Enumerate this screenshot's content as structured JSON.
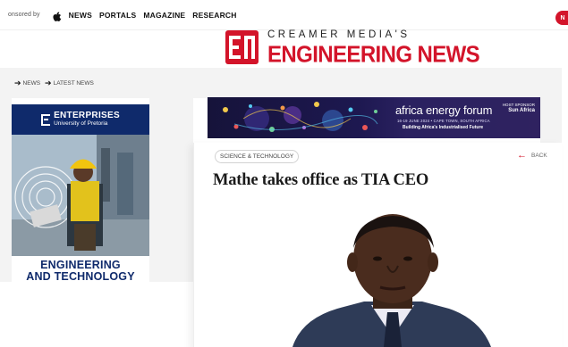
{
  "topbar": {
    "sponsored_text": "onsored by",
    "nav": [
      "NEWS",
      "PORTALS",
      "MAGAZINE",
      "RESEARCH"
    ],
    "user_badge": "N"
  },
  "logo": {
    "top": "CREAMER MEDIA'S",
    "bottom": "ENGINEERING NEWS"
  },
  "breadcrumb": [
    "NEWS",
    "LATEST NEWS"
  ],
  "left_ad": {
    "brand": "ENTERPRISES",
    "brand_sub": "University of Pretoria",
    "foot_line1": "ENGINEERING",
    "foot_line2": "AND TECHNOLOGY"
  },
  "banner": {
    "title": "africa energy forum",
    "sub1": "16-19 JUNE 2024 • CAPE TOWN, SOUTH AFRICA",
    "sub2": "Building Africa's Industrialised Future",
    "sponsor_label": "HOST SPONSOR",
    "sponsor_name": "Sun Africa"
  },
  "article": {
    "category": "SCIENCE & TECHNOLOGY",
    "back_label": "BACK",
    "headline": "Mathe takes office as TIA CEO"
  },
  "colors": {
    "brand_red": "#d3142a",
    "ad_navy": "#0f2a6b",
    "strip_grey": "#f3f3f3"
  },
  "icons": {
    "apple": "apple-icon",
    "arrow": "arrow-right-icon",
    "back": "arrow-left-icon"
  }
}
